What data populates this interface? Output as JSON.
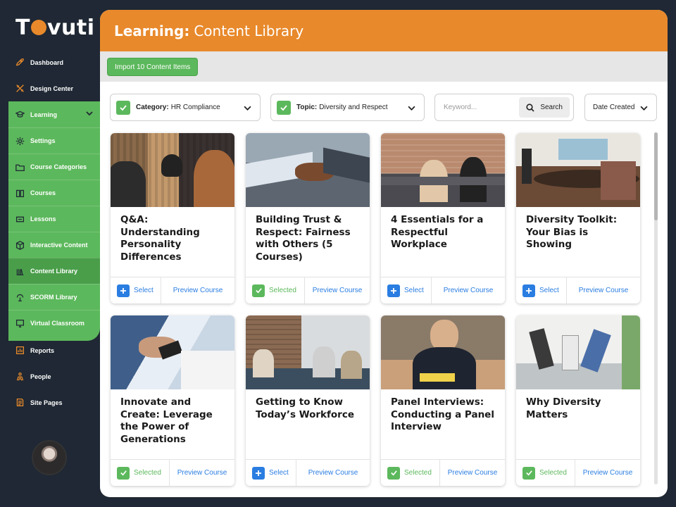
{
  "brand": {
    "logo_left": "T",
    "logo_right": "vuti",
    "accent": "#e8892b",
    "green": "#5cb85c",
    "blue": "#2a7de1"
  },
  "sidebar": {
    "items": [
      {
        "label": "Dashboard",
        "icon": "rocket-icon"
      },
      {
        "label": "Design Center",
        "icon": "tools-icon"
      },
      {
        "label": "Learning",
        "icon": "graduation-cap-icon"
      },
      {
        "label": "Settings",
        "icon": "gear-icon"
      },
      {
        "label": "Course Categories",
        "icon": "folder-icon"
      },
      {
        "label": "Courses",
        "icon": "book-icon"
      },
      {
        "label": "Lessons",
        "icon": "lessons-icon"
      },
      {
        "label": "Interactive Content",
        "icon": "cube-icon"
      },
      {
        "label": "Content Library",
        "icon": "library-icon"
      },
      {
        "label": "SCORM Library",
        "icon": "scorm-icon"
      },
      {
        "label": "Virtual Classroom",
        "icon": "virtual-classroom-icon"
      },
      {
        "label": "Reports",
        "icon": "reports-icon"
      },
      {
        "label": "People",
        "icon": "people-icon"
      },
      {
        "label": "Site Pages",
        "icon": "pages-icon"
      }
    ]
  },
  "header": {
    "title_bold": "Learning:",
    "title_rest": "Content Library"
  },
  "toolbar": {
    "import_label": "Import 10 Content Items"
  },
  "filters": {
    "category": {
      "label": "Category:",
      "value": "HR Compliance"
    },
    "topic": {
      "label": "Topic:",
      "value": "Diversity and Respect"
    },
    "keyword_placeholder": "Keyword...",
    "search_label": "Search",
    "sort_value": "Date Created"
  },
  "cards": [
    {
      "title": "Q&A: Understanding Personality Differences",
      "select_label": "Select",
      "selected": false,
      "preview_label": "Preview Course"
    },
    {
      "title": "Building Trust & Respect: Fairness with Others (5 Courses)",
      "select_label": "Selected",
      "selected": true,
      "preview_label": "Preview Course"
    },
    {
      "title": "4 Essentials for a Respectful Workplace",
      "select_label": "Select",
      "selected": false,
      "preview_label": "Preview Course"
    },
    {
      "title": "Diversity Toolkit: Your Bias is Showing",
      "select_label": "Select",
      "selected": false,
      "preview_label": "Preview Course"
    },
    {
      "title": "Innovate and Create: Leverage the Power of Generations",
      "select_label": "Selected",
      "selected": true,
      "preview_label": "Preview Course"
    },
    {
      "title": "Getting to Know Today’s Workforce",
      "select_label": "Select",
      "selected": false,
      "preview_label": "Preview Course"
    },
    {
      "title": "Panel Interviews: Conducting a Panel Interview",
      "select_label": "Selected",
      "selected": true,
      "preview_label": "Preview Course"
    },
    {
      "title": "Why Diversity Matters",
      "select_label": "Selected",
      "selected": true,
      "preview_label": "Preview Course"
    }
  ]
}
